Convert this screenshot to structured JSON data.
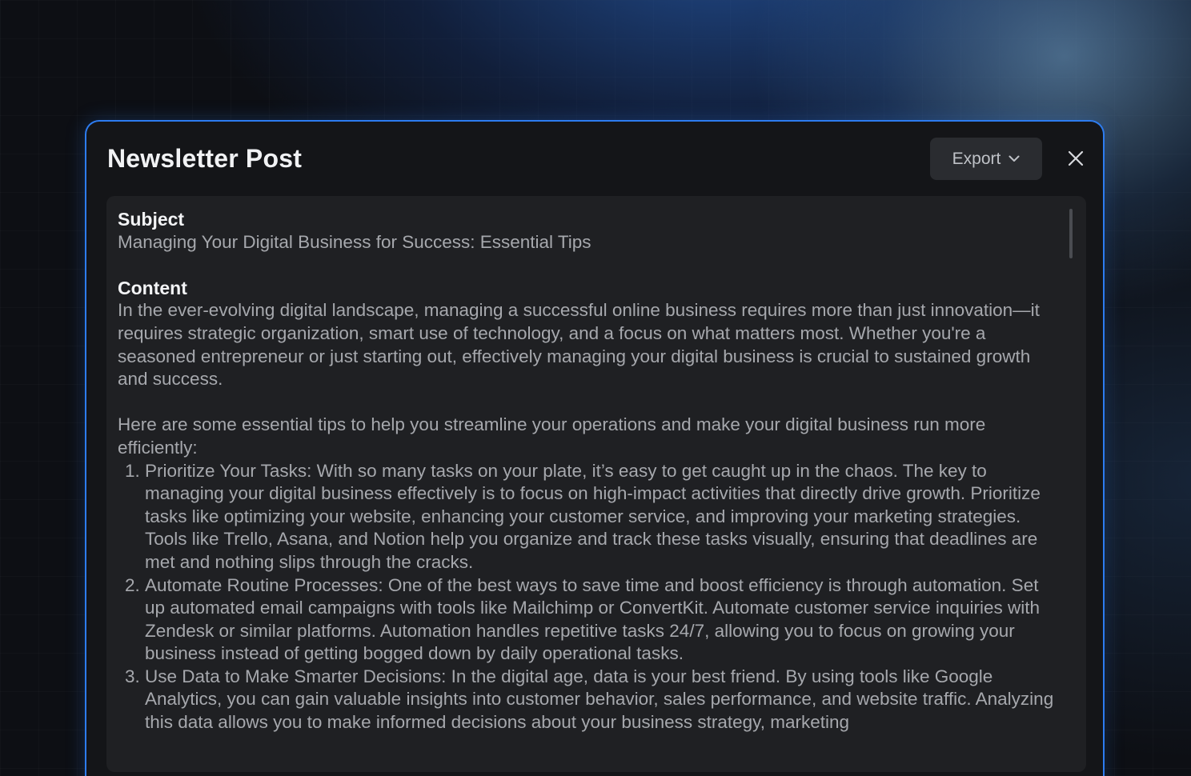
{
  "modal": {
    "title": "Newsletter Post",
    "export_label": "Export"
  },
  "subject": {
    "label": "Subject",
    "value": "Managing Your Digital Business for Success: Essential Tips"
  },
  "content": {
    "label": "Content",
    "intro": "In the ever-evolving digital landscape, managing a successful online business requires more than just innovation—it requires strategic organization, smart use of technology, and a focus on what matters most. Whether you're a seasoned entrepreneur or just starting out, effectively managing your digital business is crucial to sustained growth and success.",
    "lead": "Here are some essential tips to help you streamline your operations and make your digital business run more efficiently:",
    "tips": [
      "Prioritize Your Tasks: With so many tasks on your plate, it’s easy to get caught up in the chaos. The key to managing your digital business effectively is to focus on high-impact activities that directly drive growth. Prioritize tasks like optimizing your website, enhancing your customer service, and improving your marketing strategies. Tools like Trello, Asana, and Notion help you organize and track these tasks visually, ensuring that deadlines are met and nothing slips through the cracks.",
      "Automate Routine Processes: One of the best ways to save time and boost efficiency is through automation. Set up automated email campaigns with tools like Mailchimp or ConvertKit. Automate customer service inquiries with Zendesk or similar platforms. Automation handles repetitive tasks 24/7, allowing you to focus on growing your business instead of getting bogged down by daily operational tasks.",
      "Use Data to Make Smarter Decisions: In the digital age, data is your best friend. By using tools like Google Analytics, you can gain valuable insights into customer behavior, sales performance, and website traffic. Analyzing this data allows you to make informed decisions about your business strategy, marketing"
    ]
  },
  "icons": {
    "export_chevron": "chevron-down-icon",
    "close": "close-icon"
  },
  "colors": {
    "accent_border": "#2d7cf0",
    "modal_bg": "#141518",
    "panel_bg": "#1f2023"
  }
}
